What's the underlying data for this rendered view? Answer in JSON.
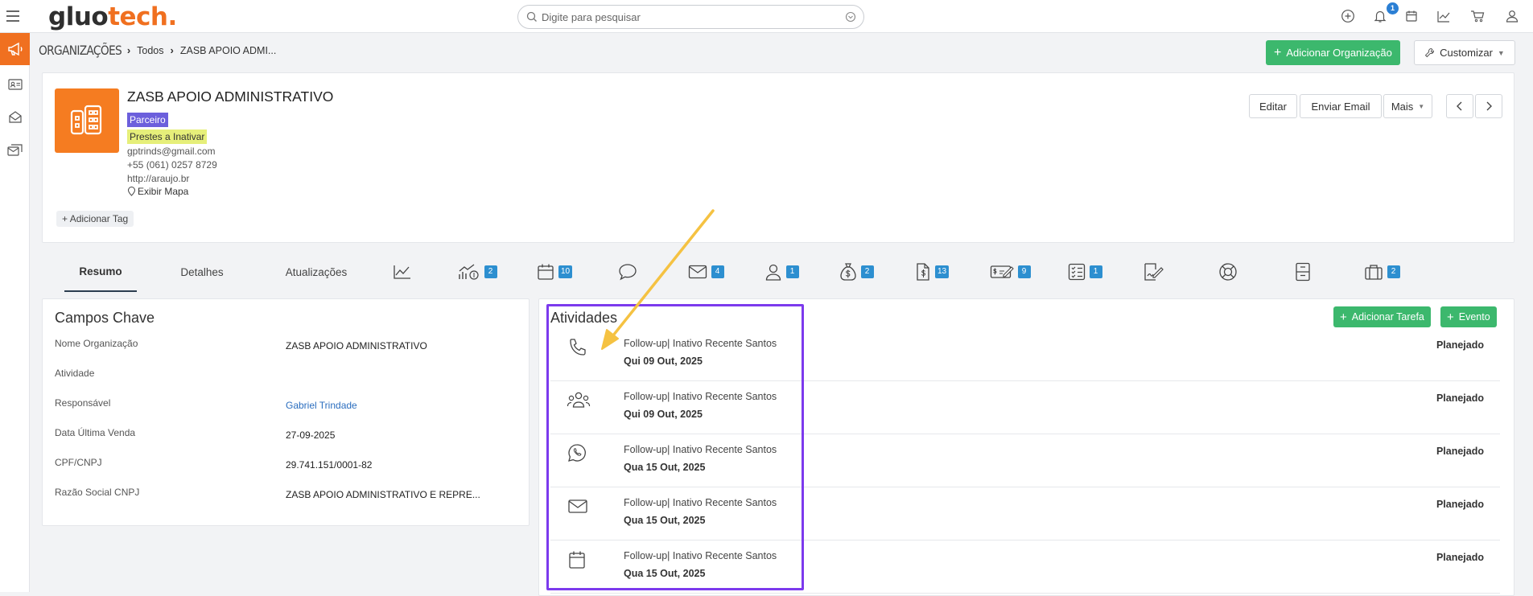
{
  "brand": {
    "logo_part1": "gluo",
    "logo_part2": "tech",
    "logo_dot": "."
  },
  "search": {
    "placeholder": "Digite para pesquisar"
  },
  "topbar": {
    "notification_count": "1",
    "icons": [
      "add-icon",
      "bell-icon",
      "calendar-icon",
      "chart-icon",
      "cart-icon",
      "user-icon"
    ]
  },
  "sidebar": {
    "icons": [
      "megaphone-icon",
      "contact-card-icon",
      "inbox-icon",
      "mail-stack-icon"
    ]
  },
  "breadcrumb": {
    "root": "ORGANIZAÇÕES",
    "level1": "Todos",
    "current": "ZASB APOIO ADMI..."
  },
  "actions": {
    "add_org": "Adicionar Organização",
    "customize": "Customizar",
    "edit": "Editar",
    "send_email": "Enviar Email",
    "more": "Mais"
  },
  "org": {
    "name": "ZASB APOIO ADMINISTRATIVO",
    "tag_partner": "Parceiro",
    "tag_status": "Prestes a Inativar",
    "email": "gptrinds@gmail.com",
    "phone": "+55 (061) 0257 8729",
    "website": "http://araujo.br",
    "map_link": "Exibir Mapa",
    "add_tag": "Adicionar Tag"
  },
  "tabs": {
    "resumo": "Resumo",
    "detalhes": "Detalhes",
    "atualizacoes": "Atualizações",
    "icon_tabs": [
      {
        "icon": "trend-chart-icon",
        "badge": ""
      },
      {
        "icon": "sales-growth-icon",
        "badge": "2"
      },
      {
        "icon": "calendar-icon",
        "badge": "10"
      },
      {
        "icon": "chat-icon",
        "badge": ""
      },
      {
        "icon": "envelope-icon",
        "badge": "4"
      },
      {
        "icon": "person-icon",
        "badge": "1"
      },
      {
        "icon": "money-bag-icon",
        "badge": "2"
      },
      {
        "icon": "invoice-icon",
        "badge": "13"
      },
      {
        "icon": "check-icon",
        "badge": "9"
      },
      {
        "icon": "checklist-icon",
        "badge": "1"
      },
      {
        "icon": "signature-icon",
        "badge": ""
      },
      {
        "icon": "lifebuoy-icon",
        "badge": ""
      },
      {
        "icon": "cabinet-icon",
        "badge": ""
      },
      {
        "icon": "briefcase-icon",
        "badge": "2"
      }
    ]
  },
  "key_fields": {
    "title": "Campos Chave",
    "rows": [
      {
        "label": "Nome Organização",
        "value": "ZASB APOIO ADMINISTRATIVO"
      },
      {
        "label": "Atividade",
        "value": ""
      },
      {
        "label": "Responsável",
        "value": "Gabriel Trindade"
      },
      {
        "label": "Data Última Venda",
        "value": "27-09-2025"
      },
      {
        "label": "CPF/CNPJ",
        "value": "29.741.151/0001-82"
      },
      {
        "label": "Razão Social CNPJ",
        "value": "ZASB APOIO ADMINISTRATIVO E REPRE..."
      }
    ]
  },
  "activities": {
    "title": "Atividades",
    "add_task": "Adicionar Tarefa",
    "add_event": "Evento",
    "items": [
      {
        "icon": "phone-icon",
        "desc": "Follow-up| Inativo Recente Santos",
        "date": "Qui 09 Out, 2025",
        "status": "Planejado"
      },
      {
        "icon": "meeting-icon",
        "desc": "Follow-up| Inativo Recente Santos",
        "date": "Qui 09 Out, 2025",
        "status": "Planejado"
      },
      {
        "icon": "whatsapp-icon",
        "desc": "Follow-up| Inativo Recente Santos",
        "date": "Qua 15 Out, 2025",
        "status": "Planejado"
      },
      {
        "icon": "email-icon",
        "desc": "Follow-up| Inativo Recente Santos",
        "date": "Qua 15 Out, 2025",
        "status": "Planejado"
      },
      {
        "icon": "calendar-icon",
        "desc": "Follow-up| Inativo Recente Santos",
        "date": "Qua 15 Out, 2025",
        "status": "Planejado"
      }
    ]
  },
  "colors": {
    "accent": "#f07020",
    "green": "#3cb86d",
    "badge_blue": "#2d8fd0",
    "highlight": "#7c3aed",
    "arrow": "#f5c242"
  }
}
